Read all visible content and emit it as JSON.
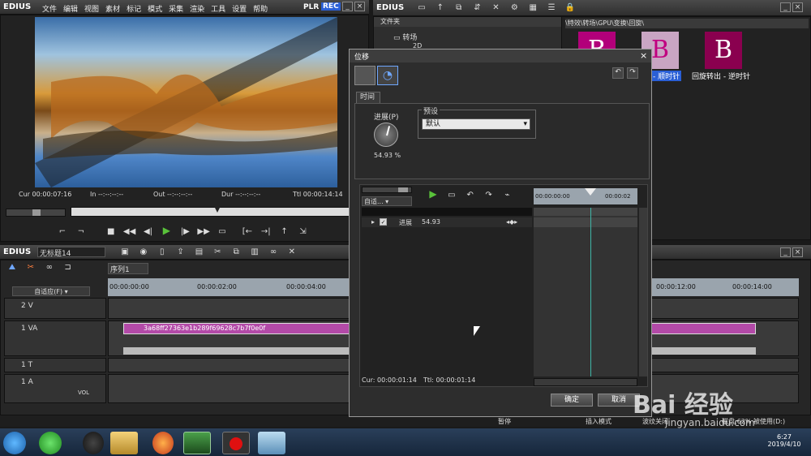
{
  "app": {
    "logo": "EDIUS",
    "menu": [
      "文件",
      "编辑",
      "视图",
      "素材",
      "标记",
      "模式",
      "采集",
      "渲染",
      "工具",
      "设置",
      "帮助"
    ],
    "plr": "PLR",
    "rec": "REC"
  },
  "player": {
    "cur": "Cur 00:00:07:16",
    "in": "In --:--:--:--",
    "out": "Out --:--:--:--",
    "dur": "Dur --:--:--:--",
    "ttl": "Ttl 00:00:14:14"
  },
  "bin": {
    "logo": "EDIUS",
    "folder_header": "文件夹",
    "tree_item1": "转场",
    "tree_item2": "2D",
    "path": "\\特效\\转场\\GPU\\变换\\回旋\\",
    "thumb_labels": [
      "- 顺时针",
      "回旋转出 - 逆时针"
    ],
    "thumb_text": "B"
  },
  "timeline": {
    "logo": "EDIUS",
    "project": "无标题14",
    "sequence_tab": "序列1",
    "fit_label": "自适应(F)",
    "ruler": [
      "00:00:00:00",
      "00:00:02:00",
      "00:00:04:00",
      "00:00:12:00",
      "00:00:14:00"
    ],
    "tracks": [
      "2 V",
      "1 VA",
      "1 T",
      "1 A"
    ],
    "clip_name": "3a68ff27363e1b289f69628c7b7f0e0f",
    "vol": "VOL"
  },
  "dialog": {
    "title": "位移",
    "tab": "时间",
    "progress_label": "进展(P)",
    "progress_value": "54.93 %",
    "preset_label": "预设",
    "preset_value": "默认",
    "fit_label": "自适...",
    "param_name": "进展",
    "param_value": "54.93",
    "ruler_start": "00:00:00:00",
    "ruler_end": "00:00:02",
    "cur": "Cur: 00:00:01:14",
    "ttl": "Ttl: 00:00:01:14",
    "ok": "确定",
    "cancel": "取消",
    "progress_fraction": 0.5493
  },
  "status": {
    "pause": "暂停",
    "insert_mode": "插入模式",
    "ripple": "波纹关闭",
    "disk": "磁盘:62% 被使用(D:)"
  },
  "taskbar": {
    "time": "6:27",
    "date": "2019/4/10"
  },
  "watermark": {
    "brand": "Bai 经验",
    "url": "jingyan.baidu.com"
  },
  "colors": {
    "accent_clip": "#b34aa8",
    "play_green": "#59c23a",
    "rec_blue": "#2a5fd6"
  }
}
